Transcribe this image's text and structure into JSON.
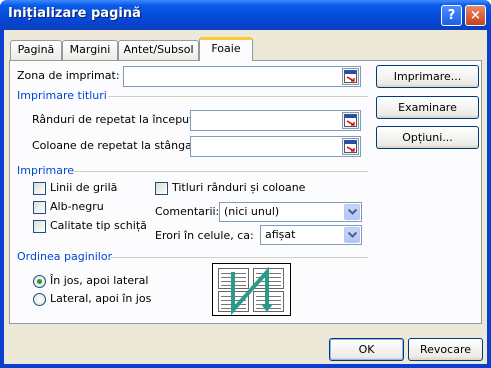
{
  "dialog": {
    "title": "Inițializare pagină",
    "help_glyph": "?",
    "close_glyph": "×"
  },
  "tabs": [
    {
      "label": "Pagină",
      "active": false
    },
    {
      "label": "Margini",
      "active": false
    },
    {
      "label": "Antet/Subsol",
      "active": false
    },
    {
      "label": "Foaie",
      "active": true
    }
  ],
  "print_area": {
    "label": "Zona de imprimat:",
    "value": ""
  },
  "print_titles": {
    "heading": "Imprimare titluri",
    "rows_label": "Rânduri de repetat la început:",
    "rows_value": "",
    "cols_label": "Coloane de repetat la stânga:",
    "cols_value": ""
  },
  "print_section": {
    "heading": "Imprimare",
    "gridlines": {
      "label": "Linii de grilă",
      "checked": false
    },
    "black_white": {
      "label": "Alb-negru",
      "checked": false
    },
    "draft_quality": {
      "label": "Calitate tip schiță",
      "checked": false
    },
    "row_col_headings": {
      "label": "Titluri rânduri și coloane",
      "checked": false
    },
    "comments_label": "Comentarii:",
    "comments_value": "(nici unul)",
    "errors_label": "Erori în celule, ca:",
    "errors_value": "afișat"
  },
  "page_order": {
    "heading": "Ordinea paginilor",
    "down_then_over": {
      "label": "În jos, apoi lateral",
      "selected": true
    },
    "over_then_down": {
      "label": "Lateral, apoi în jos",
      "selected": false
    }
  },
  "side_buttons": {
    "print": "Imprimare...",
    "preview": "Examinare",
    "options": "Opțiuni..."
  },
  "footer": {
    "ok": "OK",
    "cancel": "Revocare"
  },
  "colors": {
    "title_bar": "#0a5ae8",
    "section_heading": "#0046d5",
    "dialog_face": "#ece9d8",
    "radio_selected": "#21a121",
    "order_arrow": "#2a9a8a"
  }
}
